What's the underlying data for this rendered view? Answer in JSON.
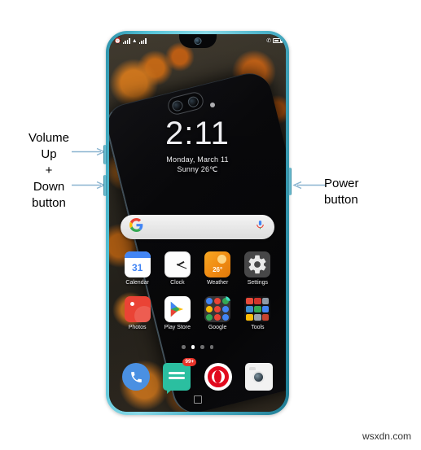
{
  "annotations": {
    "volume": {
      "line1": "Volume",
      "line2": "Up",
      "line3": "+",
      "line4": "Down",
      "line5": "button",
      "arrow_up_name": "arrow-right-volume-up",
      "arrow_down_name": "arrow-right-volume-down"
    },
    "power": {
      "line1": "Power",
      "line2": "button",
      "arrow_name": "arrow-left-power"
    },
    "arrow_color": "#8ab4d0"
  },
  "phone": {
    "frame_color": "#4fb4ca",
    "hardware_buttons": {
      "volume_up": "Volume Up",
      "volume_down": "Volume Down",
      "power": "Power"
    }
  },
  "statusbar": {
    "left_icons": [
      "alarm-icon",
      "signal-bars-icon",
      "wifi-icon",
      "signal-bars-2-icon"
    ],
    "right_icons": [
      "mute-icon",
      "battery-icon"
    ]
  },
  "clock_widget": {
    "time": "2:11",
    "date": "Monday, March 11",
    "weather": "Sunny 26℃"
  },
  "search": {
    "google_letter": "G",
    "mic_icon": "microphone-icon",
    "placeholder": ""
  },
  "apps": {
    "row1": [
      {
        "label": "Calendar",
        "icon": "calendar-icon",
        "day": "31"
      },
      {
        "label": "Clock",
        "icon": "clock-icon"
      },
      {
        "label": "Weather",
        "icon": "weather-icon",
        "temp": "26°"
      },
      {
        "label": "Settings",
        "icon": "gear-icon"
      }
    ],
    "row2": [
      {
        "label": "Photos",
        "icon": "photos-icon"
      },
      {
        "label": "Play Store",
        "icon": "play-store-icon"
      },
      {
        "label": "Google",
        "icon": "google-folder-icon",
        "badge": true
      },
      {
        "label": "Tools",
        "icon": "tools-folder-icon"
      }
    ]
  },
  "page_indicator": {
    "count": 4,
    "active": 2
  },
  "dock": [
    {
      "label": "Phone",
      "icon": "phone-icon"
    },
    {
      "label": "Messages",
      "icon": "messages-icon",
      "badge": "99+"
    },
    {
      "label": "Opera",
      "icon": "opera-icon"
    },
    {
      "label": "Camera",
      "icon": "camera-icon"
    }
  ],
  "nav_hint": "recents-square-icon",
  "watermark": "wsxdn.com"
}
